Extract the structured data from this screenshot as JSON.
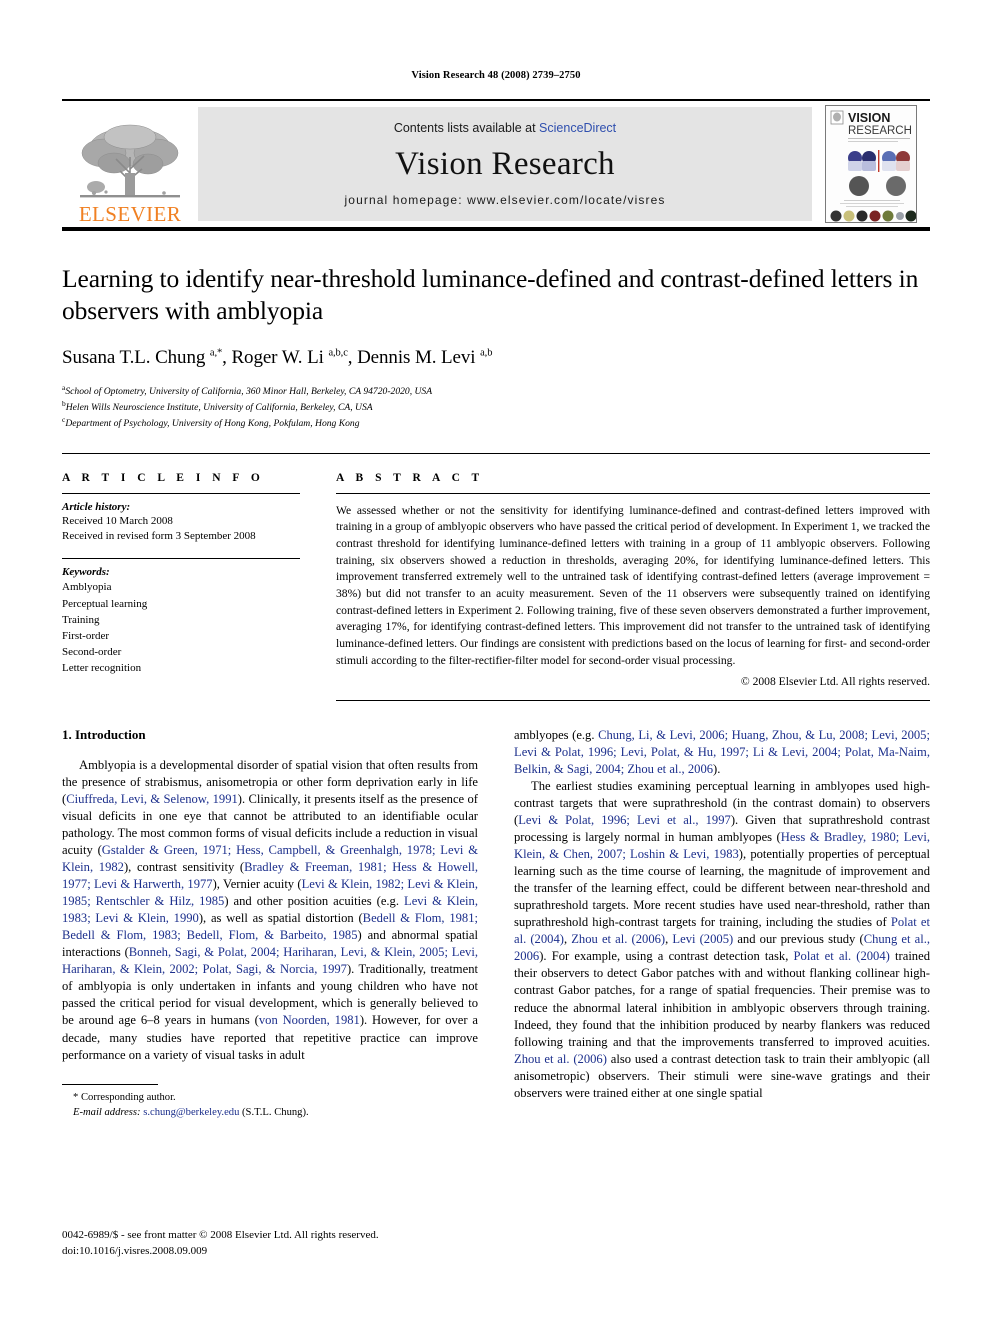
{
  "running_head": "Vision Research 48 (2008) 2739–2750",
  "masthead": {
    "publisher_name": "ELSEVIER",
    "publisher_logo_icon": "elsevier-tree-icon",
    "contents_prefix": "Contents lists available at ",
    "sciencedirect_label": "ScienceDirect",
    "journal_name": "Vision Research",
    "homepage_line": "journal homepage: www.elsevier.com/locate/visres",
    "cover_title_line1": "VISION",
    "cover_title_line2": "RESEARCH",
    "sciencedirect_color": "#2f4fae",
    "band_color": "#e4e4e4",
    "elsevier_orange": "#f08022"
  },
  "article": {
    "title": "Learning to identify near-threshold luminance-defined and contrast-defined letters in observers with amblyopia",
    "authors_html": "Susana T.L. Chung <sup>a,*</sup>, Roger W. Li <sup>a,b,c</sup>, Dennis M. Levi <sup>a,b</sup>",
    "affiliations": [
      {
        "marker": "a",
        "text": "School of Optometry, University of California, 360 Minor Hall, Berkeley, CA 94720-2020, USA"
      },
      {
        "marker": "b",
        "text": "Helen Wills Neuroscience Institute, University of California, Berkeley, CA, USA"
      },
      {
        "marker": "c",
        "text": "Department of Psychology, University of Hong Kong, Pokfulam, Hong Kong"
      }
    ]
  },
  "article_info": {
    "heading": "A R T I C L E   I N F O",
    "history_label": "Article history:",
    "history_lines": [
      "Received 10 March 2008",
      "Received in revised form 3 September 2008"
    ],
    "keywords_label": "Keywords:",
    "keywords": [
      "Amblyopia",
      "Perceptual learning",
      "Training",
      "First-order",
      "Second-order",
      "Letter recognition"
    ]
  },
  "abstract": {
    "heading": "A B S T R A C T",
    "text": "We assessed whether or not the sensitivity for identifying luminance-defined and contrast-defined letters improved with training in a group of amblyopic observers who have passed the critical period of development. In Experiment 1, we tracked the contrast threshold for identifying luminance-defined letters with training in a group of 11 amblyopic observers. Following training, six observers showed a reduction in thresholds, averaging 20%, for identifying luminance-defined letters. This improvement transferred extremely well to the untrained task of identifying contrast-defined letters (average improvement = 38%) but did not transfer to an acuity measurement. Seven of the 11 observers were subsequently trained on identifying contrast-defined letters in Experiment 2. Following training, five of these seven observers demonstrated a further improvement, averaging 17%, for identifying contrast-defined letters. This improvement did not transfer to the untrained task of identifying luminance-defined letters. Our findings are consistent with predictions based on the locus of learning for first- and second-order stimuli according to the filter-rectifier-filter model for second-order visual processing.",
    "copyright": "© 2008 Elsevier Ltd. All rights reserved."
  },
  "body": {
    "section_heading": "1. Introduction",
    "citation_color": "#1c2f8c",
    "left_paragraph_html": "Amblyopia is a developmental disorder of spatial vision that often results from the presence of strabismus, anisometropia or other form deprivation early in life (<span class=\"cit\">Ciuffreda, Levi, &amp; Selenow, 1991</span>). Clinically, it presents itself as the presence of visual deficits in one eye that cannot be attributed to an identifiable ocular pathology. The most common forms of visual deficits include a reduction in visual acuity (<span class=\"cit\">Gstalder &amp; Green, 1971; Hess, Campbell, &amp; Greenhalgh, 1978; Levi &amp; Klein, 1982</span>), contrast sensitivity (<span class=\"cit\">Bradley &amp; Freeman, 1981; Hess &amp; Howell, 1977; Levi &amp; Harwerth, 1977</span>), Vernier acuity (<span class=\"cit\">Levi &amp; Klein, 1982; Levi &amp; Klein, 1985; Rentschler &amp; Hilz, 1985</span>) and other position acuities (e.g. <span class=\"cit\">Levi &amp; Klein, 1983; Levi &amp; Klein, 1990</span>), as well as spatial distortion (<span class=\"cit\">Bedell &amp; Flom, 1981; Bedell &amp; Flom, 1983; Bedell, Flom, &amp; Barbeito, 1985</span>) and abnormal spatial interactions (<span class=\"cit\">Bonneh, Sagi, &amp; Polat, 2004; Hariharan, Levi, &amp; Klein, 2005; Levi, Hariharan, &amp; Klein, 2002; Polat, Sagi, &amp; Norcia, 1997</span>). Traditionally, treatment of amblyopia is only undertaken in infants and young children who have not passed the critical period for visual development, which is generally believed to be around age 6–8 years in humans (<span class=\"cit\">von Noorden, 1981</span>). However, for over a decade, many studies have reported that repetitive practice can improve performance on a variety of visual tasks in adult",
    "right_paragraph_1_html": "amblyopes (e.g. <span class=\"cit\">Chung, Li, &amp; Levi, 2006; Huang, Zhou, &amp; Lu, 2008; Levi, 2005; Levi &amp; Polat, 1996; Levi, Polat, &amp; Hu, 1997; Li &amp; Levi, 2004; Polat, Ma-Naim, Belkin, &amp; Sagi, 2004; Zhou et al., 2006</span>).",
    "right_paragraph_2_html": "The earliest studies examining perceptual learning in amblyopes used high-contrast targets that were suprathreshold (in the contrast domain) to observers (<span class=\"cit\">Levi &amp; Polat, 1996; Levi et al., 1997</span>). Given that suprathreshold contrast processing is largely normal in human amblyopes (<span class=\"cit\">Hess &amp; Bradley, 1980; Levi, Klein, &amp; Chen, 2007; Loshin &amp; Levi, 1983</span>), potentially properties of perceptual learning such as the time course of learning, the magnitude of improvement and the transfer of the learning effect, could be different between near-threshold and suprathreshold targets. More recent studies have used near-threshold, rather than suprathreshold high-contrast targets for training, including the studies of <span class=\"cit\">Polat et al. (2004)</span>, <span class=\"cit\">Zhou et al. (2006)</span>, <span class=\"cit\">Levi (2005)</span> and our previous study (<span class=\"cit\">Chung et al., 2006</span>). For example, using a contrast detection task, <span class=\"cit\">Polat et al. (2004)</span> trained their observers to detect Gabor patches with and without flanking collinear high-contrast Gabor patches, for a range of spatial frequencies. Their premise was to reduce the abnormal lateral inhibition in amblyopic observers through training. Indeed, they found that the inhibition produced by nearby flankers was reduced following training and that the improvements transferred to improved acuities. <span class=\"cit\">Zhou et al. (2006)</span> also used a contrast detection task to train their amblyopic (all anisometropic) observers. Their stimuli were sine-wave gratings and their observers were trained either at one single spatial"
  },
  "footnote": {
    "marker": "*",
    "corresponding": "Corresponding author.",
    "email_label": "E-mail address:",
    "email": "s.chung@berkeley.edu",
    "email_suffix": "(S.T.L. Chung)."
  },
  "bottom_matter": {
    "line1": "0042-6989/$ - see front matter © 2008 Elsevier Ltd. All rights reserved.",
    "line2": "doi:10.1016/j.visres.2008.09.009"
  }
}
